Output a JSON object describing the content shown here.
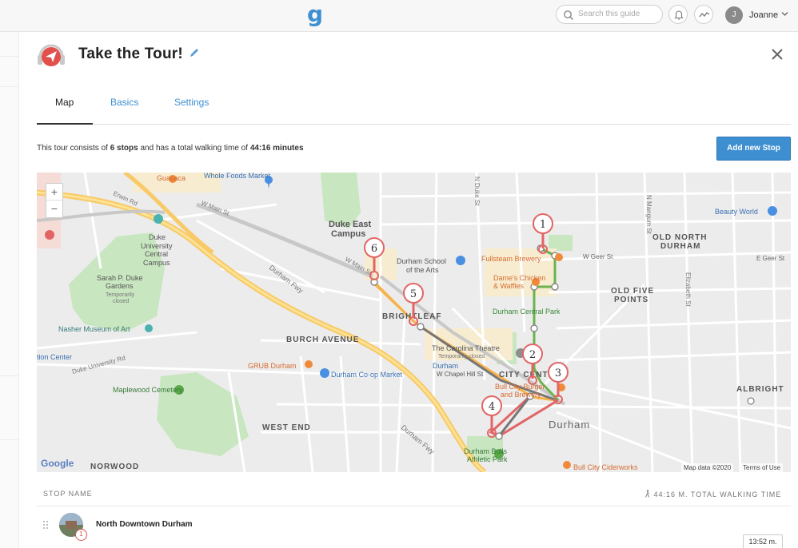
{
  "app": {
    "logo": "g"
  },
  "topbar": {
    "search_placeholder": "Search this guide",
    "user_initial": "J",
    "user_name": "Joanne"
  },
  "tour": {
    "title": "Take the Tour!",
    "tabs": [
      {
        "label": "Map",
        "active": true
      },
      {
        "label": "Basics",
        "active": false
      },
      {
        "label": "Settings",
        "active": false
      }
    ],
    "summary": {
      "prefix": "This tour consists of",
      "stops": "6 stops",
      "middle": "and has a total walking time of",
      "time": "44:16 minutes"
    },
    "add_stop_label": "Add new Stop"
  },
  "map": {
    "zoom_in": "+",
    "zoom_out": "−",
    "google_label": "Google",
    "attribution": "Map data ©2020",
    "terms": "Terms of Use",
    "markers": [
      "1",
      "2",
      "3",
      "4",
      "5",
      "6"
    ],
    "places": {
      "guasaca": "Guasaca",
      "whole_foods": "Whole Foods Market",
      "duke_east": "Duke East",
      "campus": "Campus",
      "duke_univ": "Duke",
      "duke_univ2": "University",
      "duke_univ3": "Central",
      "duke_univ4": "Campus",
      "duke_gardens1": "Sarah P. Duke",
      "duke_gardens2": "Gardens",
      "duke_gardens3": "Temporarily",
      "duke_gardens4": "closed",
      "nasher": "Nasher Museum of Art",
      "durham_school1": "Durham School",
      "durham_school2": "of the Arts",
      "fullsteam": "Fullsteam Brewery",
      "dames1": "Dame's Chicken",
      "dames2": "& Waffles",
      "central_park": "Durham Central Park",
      "beauty_world": "Beauty World",
      "old_north1": "OLD NORTH",
      "old_north2": "DURHAM",
      "old_five1": "OLD FIVE",
      "old_five2": "POINTS",
      "brightleaf": "BRIGHTLEAF",
      "burch": "BURCH AVENUE",
      "grub": "GRUB Durham",
      "coop": "Durham Co-op Market",
      "carolina1": "The Carolina Theatre",
      "carolina2": "Temporarily closed",
      "durham_small": "Durham",
      "city_center": "CITY CENTER",
      "bull_city1": "Bull City Burger",
      "bull_city2": "and Brewery",
      "maplewood": "Maplewood Cemetery",
      "west_end": "WEST END",
      "durham_big": "Durham",
      "bulls1": "Durham Bulls",
      "bulls2": "Athletic Park",
      "albright": "ALBRIGHT",
      "norwood": "NORWOOD",
      "ciderworks": "Bull City Ciderworks",
      "center": "tion Center",
      "duke_fwy": "Durham Fwy",
      "duke_fwy2": "Durham Fwy",
      "w_main": "W Main St",
      "w_main2": "W Main St",
      "erwin": "Erwin Rd",
      "duke_univ_rd": "Duke University Rd",
      "w_chapel": "W Chapel Hill St",
      "n_mangum": "N Mangum St",
      "elizabeth": "Elizabeth St",
      "n_duke": "N Duke St",
      "w_geer": "W Geer St",
      "e_geer": "E Geer St"
    }
  },
  "stops_table": {
    "col_stop": "STOP NAME",
    "col_walk": "44:16 M. TOTAL WALKING TIME",
    "rows": [
      {
        "number": "1",
        "name": "North Downtown Durham",
        "time": "13:52 m."
      }
    ]
  }
}
